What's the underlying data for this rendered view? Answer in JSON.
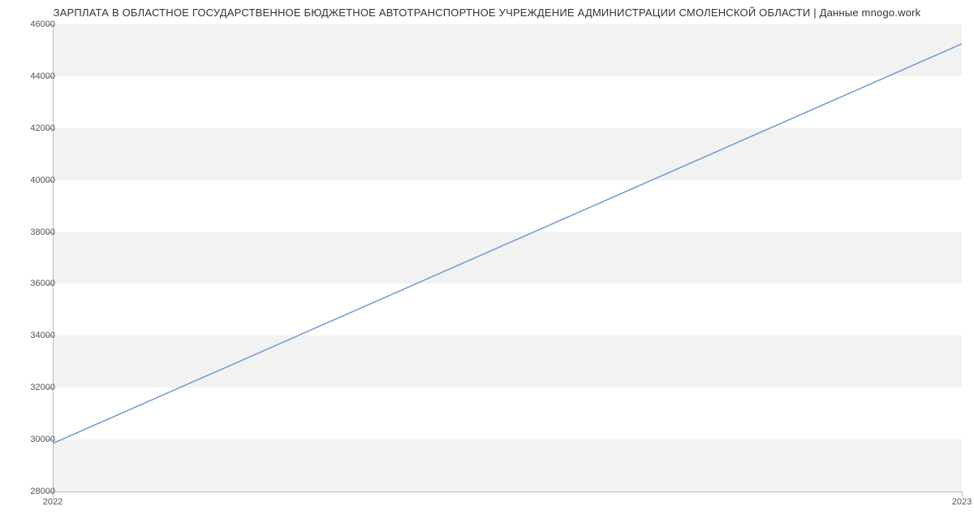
{
  "chart_data": {
    "type": "line",
    "title": "ЗАРПЛАТА В ОБЛАСТНОЕ ГОСУДАРСТВЕННОЕ БЮДЖЕТНОЕ АВТОТРАНСПОРТНОЕ УЧРЕЖДЕНИЕ АДМИНИСТРАЦИИ СМОЛЕНСКОЙ ОБЛАСТИ | Данные mnogo.work",
    "categories": [
      "2022",
      "2023"
    ],
    "values": [
      29850,
      45250
    ],
    "xlabel": "",
    "ylabel": "",
    "ylim": [
      28000,
      46000
    ],
    "y_ticks": [
      28000,
      30000,
      32000,
      34000,
      36000,
      38000,
      40000,
      42000,
      44000,
      46000
    ],
    "line_color": "#6f9ad3"
  }
}
